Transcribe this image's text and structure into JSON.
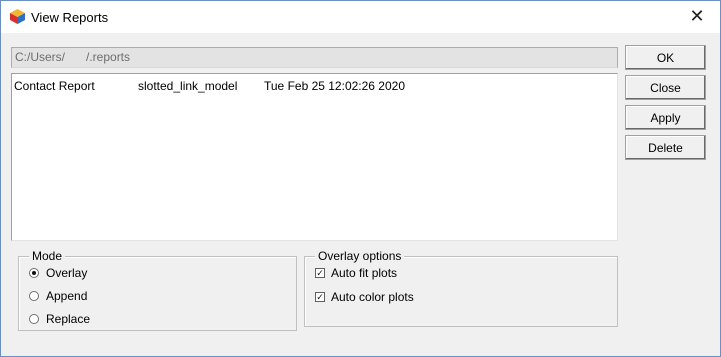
{
  "window": {
    "title": "View Reports"
  },
  "path": {
    "value": "C:/Users/       /.reports"
  },
  "reports": [
    {
      "name": "Contact Report",
      "model": "slotted_link_model",
      "date": "Tue Feb 25 12:02:26 2020"
    }
  ],
  "buttons": {
    "ok": "OK",
    "close": "Close",
    "apply": "Apply",
    "delete": "Delete"
  },
  "mode": {
    "label": "Mode",
    "options": [
      "Overlay",
      "Append",
      "Replace"
    ],
    "selected": "Overlay"
  },
  "overlay_options": {
    "label": "Overlay options",
    "auto_fit": {
      "label": "Auto fit plots",
      "checked": true
    },
    "auto_color": {
      "label": "Auto color plots",
      "checked": true
    }
  },
  "icons": {
    "app": "app-cube-icon",
    "close": "close-icon",
    "radio": "radio-icon",
    "checkbox": "checkbox-icon"
  }
}
